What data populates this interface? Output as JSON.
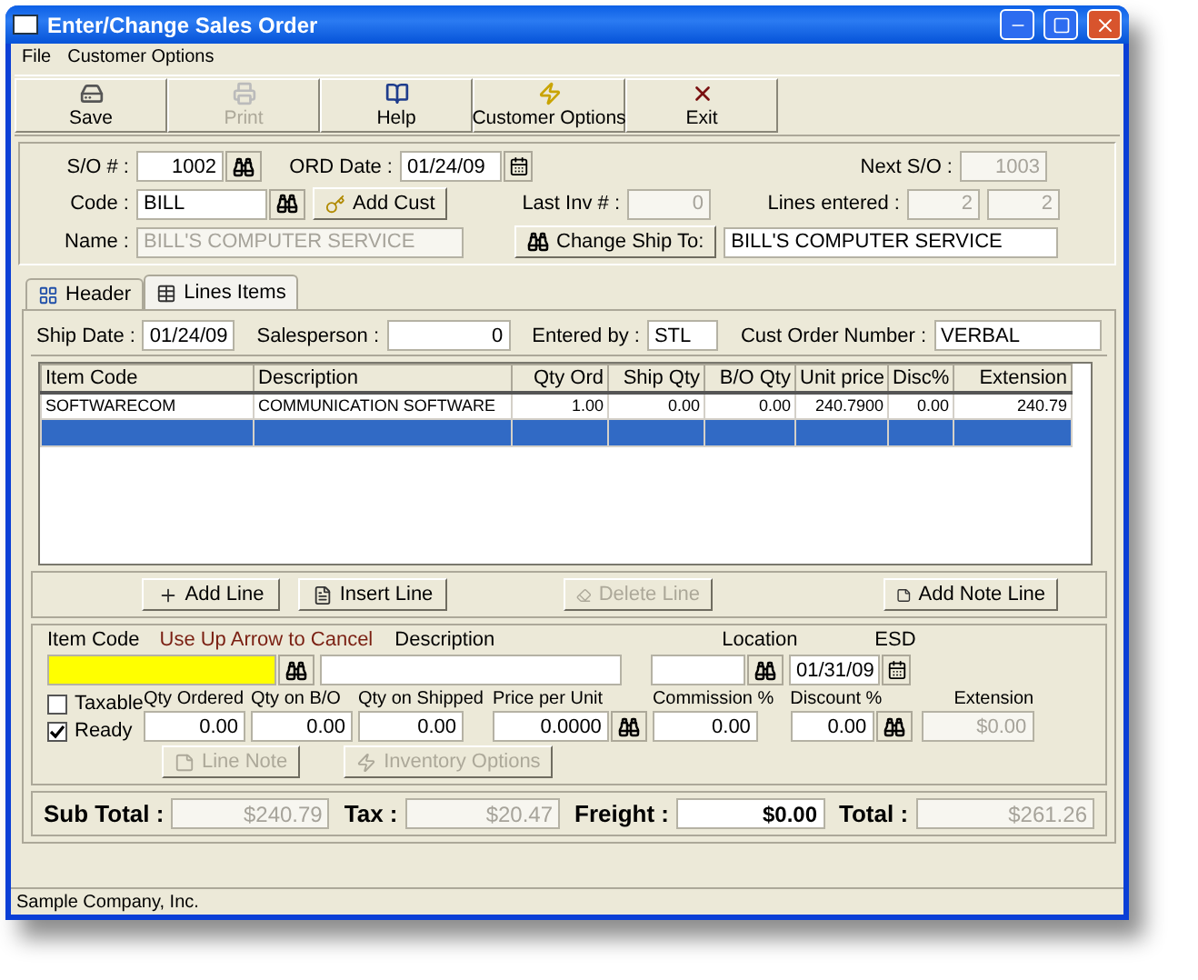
{
  "window": {
    "title": "Enter/Change Sales Order"
  },
  "menu": [
    {
      "label": "File"
    },
    {
      "label": "Customer Options"
    }
  ],
  "toolbar": [
    {
      "kind": "save",
      "label": "Save",
      "disabled": false
    },
    {
      "kind": "print",
      "label": "Print",
      "disabled": true
    },
    {
      "kind": "help",
      "label": "Help",
      "disabled": false
    },
    {
      "kind": "options",
      "label": "Customer Options",
      "disabled": false
    },
    {
      "kind": "exit",
      "label": "Exit",
      "disabled": false
    }
  ],
  "header": {
    "so_number": {
      "label": "S/O # :",
      "value": "1002",
      "disabled": false
    },
    "ord_date": {
      "label": "ORD Date :",
      "value": "01/24/09",
      "disabled": false
    },
    "next_so": {
      "label": "Next S/O :",
      "value": "1003",
      "disabled": true
    },
    "code": {
      "label": "Code :",
      "value": "BILL",
      "disabled": false
    },
    "add_cust": {
      "label": "Add Cust"
    },
    "last_inv": {
      "label": "Last Inv # :",
      "value": "0",
      "disabled": true
    },
    "lines_entered": {
      "label": "Lines entered :",
      "values": [
        "2",
        "2"
      ],
      "disabled": true
    },
    "name": {
      "label": "Name :",
      "value": "BILL'S COMPUTER SERVICE",
      "disabled": true
    },
    "change_ship_to": {
      "label": "Change Ship To:"
    },
    "ship_to_name": {
      "value": "BILL'S COMPUTER SERVICE",
      "disabled": false
    }
  },
  "tabs": [
    {
      "label": "Header",
      "selected": false
    },
    {
      "label": "Lines Items",
      "selected": true
    }
  ],
  "order_info": [
    {
      "label": "Ship Date :",
      "value": "01/24/09"
    },
    {
      "label": "Salesperson :",
      "value": "0"
    },
    {
      "label": "Entered by :",
      "value": "STL"
    },
    {
      "label": "Cust Order Number :",
      "value": "VERBAL"
    }
  ],
  "table": {
    "columns": [
      {
        "label": "Item Code"
      },
      {
        "label": "Description"
      },
      {
        "label": "Qty Ord"
      },
      {
        "label": "Ship Qty"
      },
      {
        "label": "B/O Qty"
      },
      {
        "label": "Unit price"
      },
      {
        "label": "Disc%"
      },
      {
        "label": "Extension"
      }
    ],
    "rows": [
      {
        "cells": [
          "SOFTWARECOM",
          "COMMUNICATION SOFTWARE",
          "1.00",
          "0.00",
          "0.00",
          "240.7900",
          "0.00",
          "240.79"
        ],
        "selected": false
      },
      {
        "selected": true
      }
    ]
  },
  "line_buttons": [
    {
      "kind": "add",
      "label": "Add Line",
      "disabled": false
    },
    {
      "kind": "insert",
      "label": "Insert Line",
      "disabled": false
    },
    {
      "kind": "delete",
      "label": "Delete Line",
      "disabled": true
    },
    {
      "kind": "note",
      "label": "Add Note Line",
      "disabled": false
    }
  ],
  "entry": {
    "item_code": {
      "label": "Item Code",
      "hint": "Use Up Arrow to Cancel"
    },
    "description": {
      "label": "Description"
    },
    "location": {
      "label": "Location"
    },
    "esd": {
      "label": "ESD",
      "value": "01/31/09"
    },
    "checkboxes": [
      {
        "label": "Taxable",
        "checked": false
      },
      {
        "label": "Ready",
        "checked": true
      }
    ],
    "fields": [
      {
        "label": "Qty Ordered",
        "value": "0.00",
        "lookup": false,
        "disabled": false
      },
      {
        "label": "Qty on B/O",
        "value": "0.00",
        "lookup": false,
        "disabled": false
      },
      {
        "label": "Qty on Shipped",
        "value": "0.00",
        "lookup": false,
        "disabled": false
      },
      {
        "label": "Price per Unit",
        "value": "0.0000",
        "lookup": true,
        "disabled": false
      },
      {
        "label": "Commission %",
        "value": "0.00",
        "lookup": false,
        "disabled": false
      },
      {
        "label": "Discount %",
        "value": "0.00",
        "lookup": true,
        "disabled": false
      },
      {
        "label": "Extension",
        "value": "$0.00",
        "lookup": false,
        "disabled": true
      }
    ],
    "buttons": [
      {
        "kind": "note",
        "label": "Line Note",
        "disabled": true
      },
      {
        "kind": "options",
        "label": "Inventory Options",
        "disabled": true
      }
    ]
  },
  "totals": [
    {
      "label": "Sub Total :",
      "value": "$240.79",
      "disabled": true
    },
    {
      "label": "Tax :",
      "value": "$20.47",
      "disabled": true
    },
    {
      "label": "Freight :",
      "value": "$0.00",
      "disabled": false
    },
    {
      "label": "Total :",
      "value": "$261.26",
      "disabled": true
    }
  ],
  "status_bar": {
    "text": "Sample Company, Inc."
  }
}
